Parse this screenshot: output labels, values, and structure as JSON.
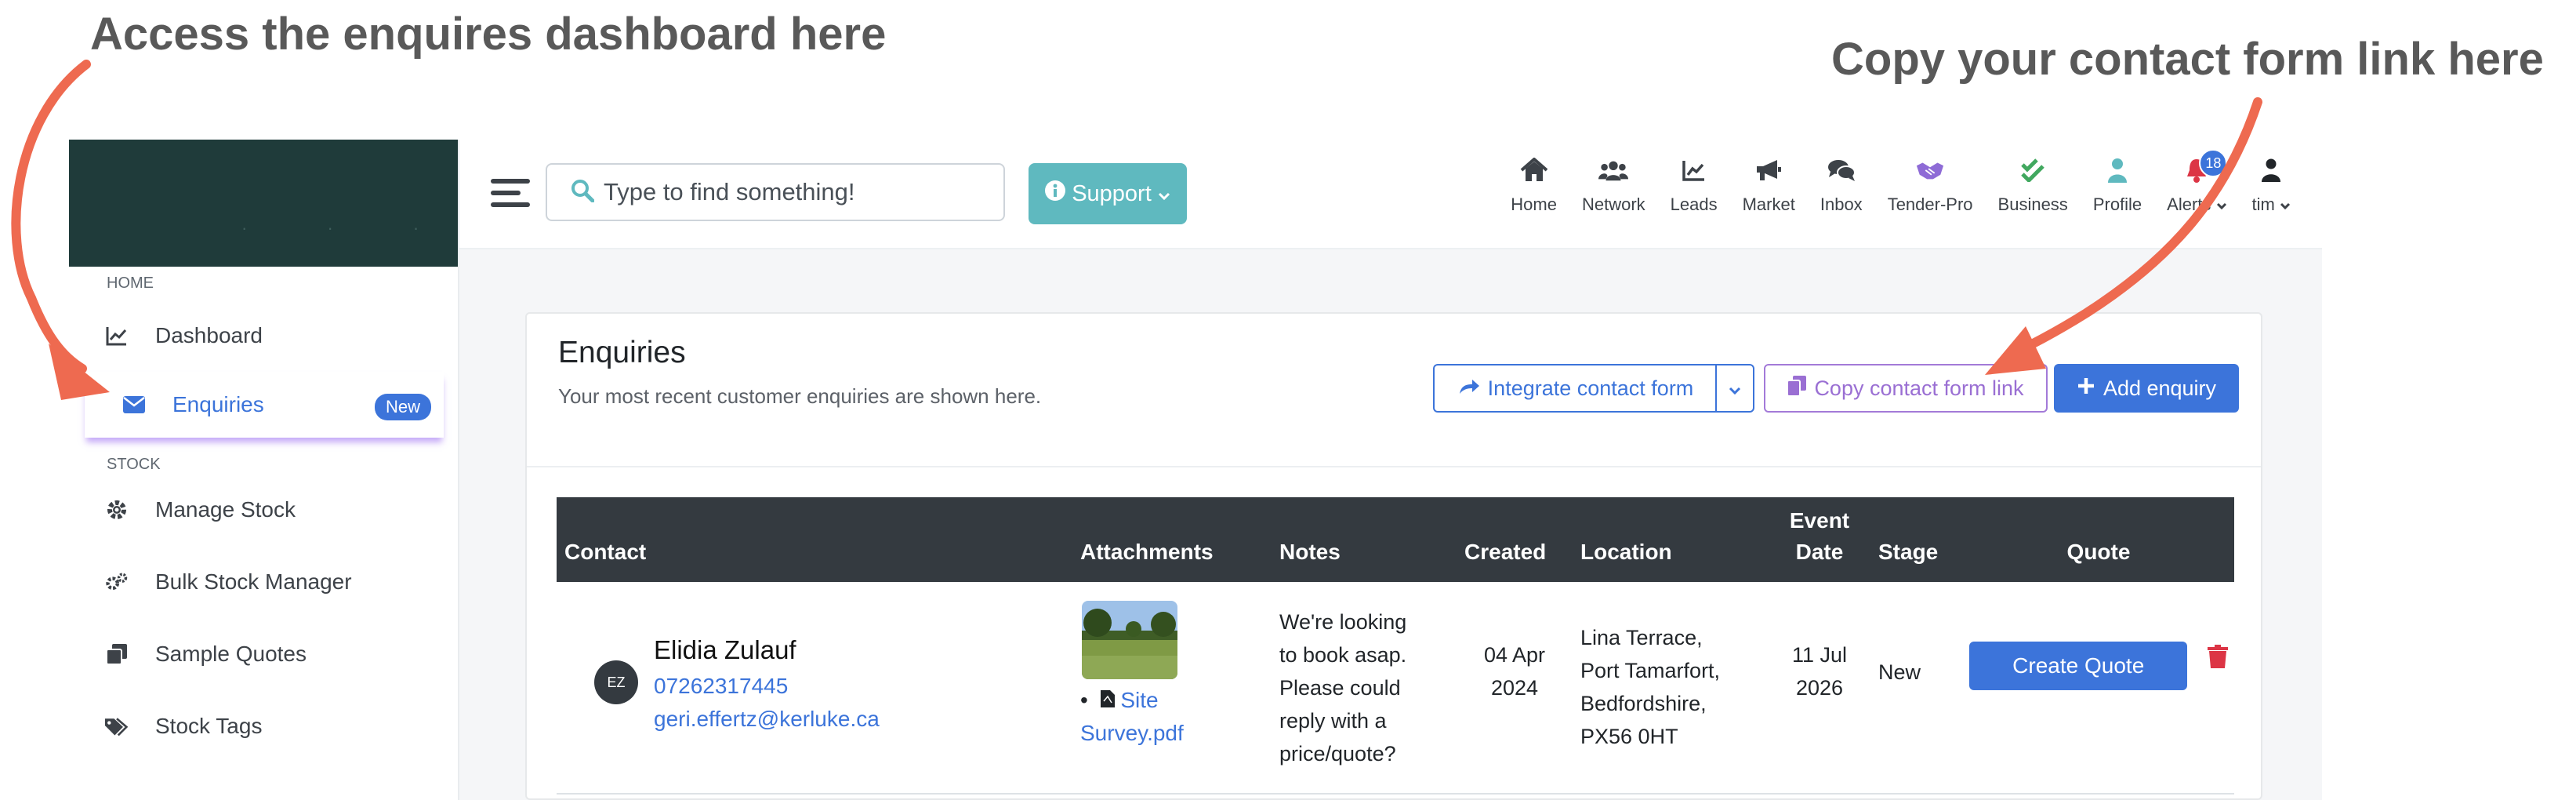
{
  "annotations": {
    "left": "Access the enquires dashboard here",
    "right": "Copy your contact form link here"
  },
  "colors": {
    "accent": "#3c74da",
    "annotation_arrow": "#ee6a50",
    "sidebar_brand": "#1f3b3a",
    "support": "#5fb9bf",
    "copy_link": "#9a6fd3"
  },
  "sidebar": {
    "section_home": "HOME",
    "dashboard": "Dashboard",
    "enquiries": "Enquiries",
    "enquiries_badge": "New",
    "section_stock": "STOCK",
    "manage_stock": "Manage Stock",
    "bulk_stock": "Bulk Stock Manager",
    "sample_quotes": "Sample Quotes",
    "stock_tags": "Stock Tags"
  },
  "topbar": {
    "search_placeholder": "Type to find something!",
    "support": "Support",
    "nav": {
      "home": "Home",
      "network": "Network",
      "leads": "Leads",
      "market": "Market",
      "inbox": "Inbox",
      "tender_pro": "Tender-Pro",
      "business": "Business",
      "profile": "Profile",
      "alerts": "Alerts",
      "alerts_count": "18",
      "user": "tim"
    }
  },
  "enquiries": {
    "title": "Enquiries",
    "subtitle": "Your most recent customer enquiries are shown here.",
    "integrate_btn": "Integrate contact form",
    "copy_btn": "Copy contact form link",
    "add_btn": "Add enquiry",
    "columns": {
      "contact": "Contact",
      "attachments": "Attachments",
      "notes": "Notes",
      "created": "Created",
      "location": "Location",
      "event_date_1": "Event",
      "event_date_2": "Date",
      "stage": "Stage",
      "quote": "Quote"
    },
    "rows": [
      {
        "initials": "EZ",
        "name": "Elidia Zulauf",
        "phone": "07262317445",
        "email": "geri.effertz@kerluke.ca",
        "attachment_1": "Site",
        "attachment_2": "Survey.pdf",
        "notes_1": "We're looking",
        "notes_2": "to book asap.",
        "notes_3": "Please could",
        "notes_4": "reply with a",
        "notes_5": "price/quote?",
        "created_1": "04 Apr",
        "created_2": "2024",
        "location_1": "Lina Terrace,",
        "location_2": "Port Tamarfort,",
        "location_3": "Bedfordshire,",
        "location_4": "PX56 0HT",
        "event_1": "11 Jul",
        "event_2": "2026",
        "stage": "New",
        "quote_btn": "Create Quote"
      }
    ]
  }
}
